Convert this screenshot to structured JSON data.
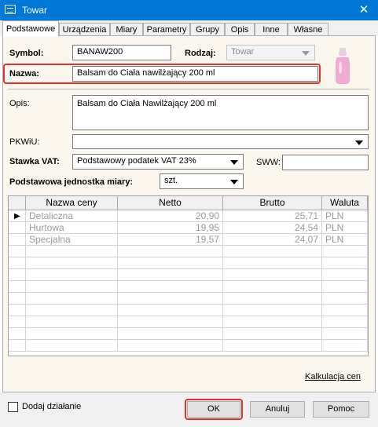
{
  "window": {
    "title": "Towar",
    "close_glyph": "✕"
  },
  "tabs": [
    {
      "label": "Podstawowe"
    },
    {
      "label": "Urządzenia"
    },
    {
      "label": "Miary"
    },
    {
      "label": "Parametry"
    },
    {
      "label": "Grupy"
    },
    {
      "label": "Opis"
    },
    {
      "label": "Inne"
    },
    {
      "label": "Własne"
    }
  ],
  "form": {
    "symbol_label": "Symbol:",
    "symbol_value": "BANAW200",
    "rodzaj_label": "Rodzaj:",
    "rodzaj_value": "Towar",
    "nazwa_label": "Nazwa:",
    "nazwa_value": "Balsam do Ciała nawilżający 200 ml",
    "opis_label": "Opis:",
    "opis_value": "Balsam do Ciała Nawilżający 200 ml",
    "pkwiu_label": "PKWiU:",
    "pkwiu_value": "",
    "vat_label": "Stawka VAT:",
    "vat_value": "Podstawowy podatek VAT 23%",
    "sww_label": "SWW:",
    "sww_value": "",
    "jm_label": "Podstawowa jednostka miary:",
    "jm_value": "szt."
  },
  "prices": {
    "headers": [
      "Nazwa ceny",
      "Netto",
      "Brutto",
      "Waluta"
    ],
    "rows": [
      {
        "name": "Detaliczna",
        "netto": "20,90",
        "brutto": "25,71",
        "waluta": "PLN"
      },
      {
        "name": "Hurtowa",
        "netto": "19,95",
        "brutto": "24,54",
        "waluta": "PLN"
      },
      {
        "name": "Specjalna",
        "netto": "19,57",
        "brutto": "24,07",
        "waluta": "PLN"
      }
    ],
    "current_row_marker": "▶"
  },
  "links": {
    "kalkulacja": "Kalkulacja cen"
  },
  "footer": {
    "add_action_label": "Dodaj działanie",
    "ok_label": "OK",
    "cancel_label": "Anuluj",
    "help_label": "Pomoc"
  },
  "colors": {
    "titlebar": "#0078d7",
    "panel_bg": "#fcf7ee",
    "highlight": "#e03030",
    "product_pink": "#f2a9d2"
  },
  "icons": [
    "app-icon",
    "close-icon",
    "dropdown-arrow-icon",
    "product-bottle-image",
    "row-pointer-icon"
  ]
}
